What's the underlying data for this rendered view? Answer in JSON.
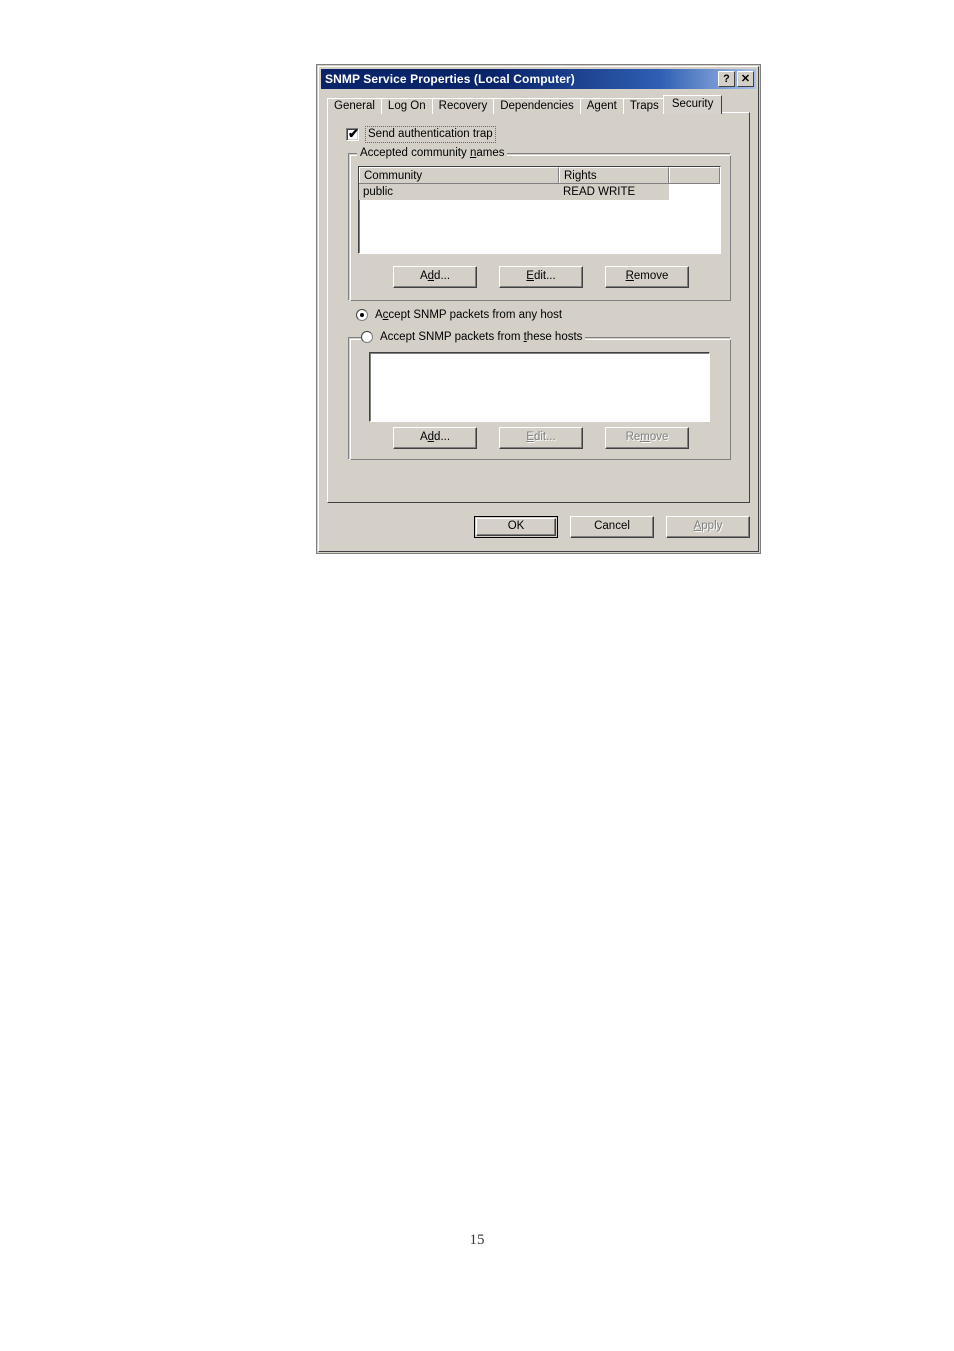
{
  "page": {
    "number": "15"
  },
  "dialog": {
    "title": "SNMP Service Properties (Local Computer)",
    "titlebar_buttons": [
      {
        "name": "help-button",
        "label": "?"
      },
      {
        "name": "close-button",
        "label": "✕"
      }
    ],
    "tabs": [
      {
        "label": "General",
        "active": false
      },
      {
        "label": "Log On",
        "active": false
      },
      {
        "label": "Recovery",
        "active": false
      },
      {
        "label": "Dependencies",
        "active": false
      },
      {
        "label": "Agent",
        "active": false
      },
      {
        "label": "Traps",
        "active": false
      },
      {
        "label": "Security",
        "active": true
      }
    ],
    "security_tab": {
      "send_auth_trap": {
        "label": "Send authentication trap",
        "checked": true,
        "checkmark": "✔",
        "focused": true
      },
      "community_group": {
        "title_before": "Accepted community ",
        "title_accel": "n",
        "title_after": "ames",
        "columns": [
          "Community",
          "Rights",
          ""
        ],
        "rows": [
          {
            "community": "public",
            "rights": "READ WRITE",
            "selected": true
          }
        ],
        "buttons": [
          {
            "name": "community-add-button",
            "before": "A",
            "accel": "d",
            "after": "d...",
            "enabled": true
          },
          {
            "name": "community-edit-button",
            "before": "",
            "accel": "E",
            "after": "dit...",
            "enabled": true
          },
          {
            "name": "community-remove-button",
            "before": "",
            "accel": "R",
            "after": "emove",
            "enabled": true
          }
        ]
      },
      "accept_any": {
        "before": "A",
        "accel": "c",
        "after": "cept SNMP packets from any host",
        "selected": true
      },
      "accept_these": {
        "before": "Accept SNMP packets from ",
        "accel": "t",
        "after": "hese hosts",
        "selected": false,
        "hosts": [],
        "buttons": [
          {
            "name": "hosts-add-button",
            "before": "A",
            "accel": "d",
            "after": "d...",
            "enabled": true
          },
          {
            "name": "hosts-edit-button",
            "before": "",
            "accel": "E",
            "after": "dit...",
            "enabled": false
          },
          {
            "name": "hosts-remove-button",
            "before": "Re",
            "accel": "m",
            "after": "ove",
            "enabled": false
          }
        ]
      }
    },
    "footer_buttons": [
      {
        "name": "ok-button",
        "label": "OK",
        "enabled": true,
        "default": true
      },
      {
        "name": "cancel-button",
        "label": "Cancel",
        "enabled": true,
        "default": false
      },
      {
        "name": "apply-button",
        "before": "",
        "accel": "A",
        "after": "pply",
        "label": "Apply",
        "enabled": false,
        "default": false
      }
    ]
  },
  "colors": {
    "face": "#d4d0c8",
    "title_start": "#0a246a",
    "title_end": "#a6c0e8",
    "window": "#ffffff",
    "text": "#000000",
    "disabled_text": "#808080"
  }
}
